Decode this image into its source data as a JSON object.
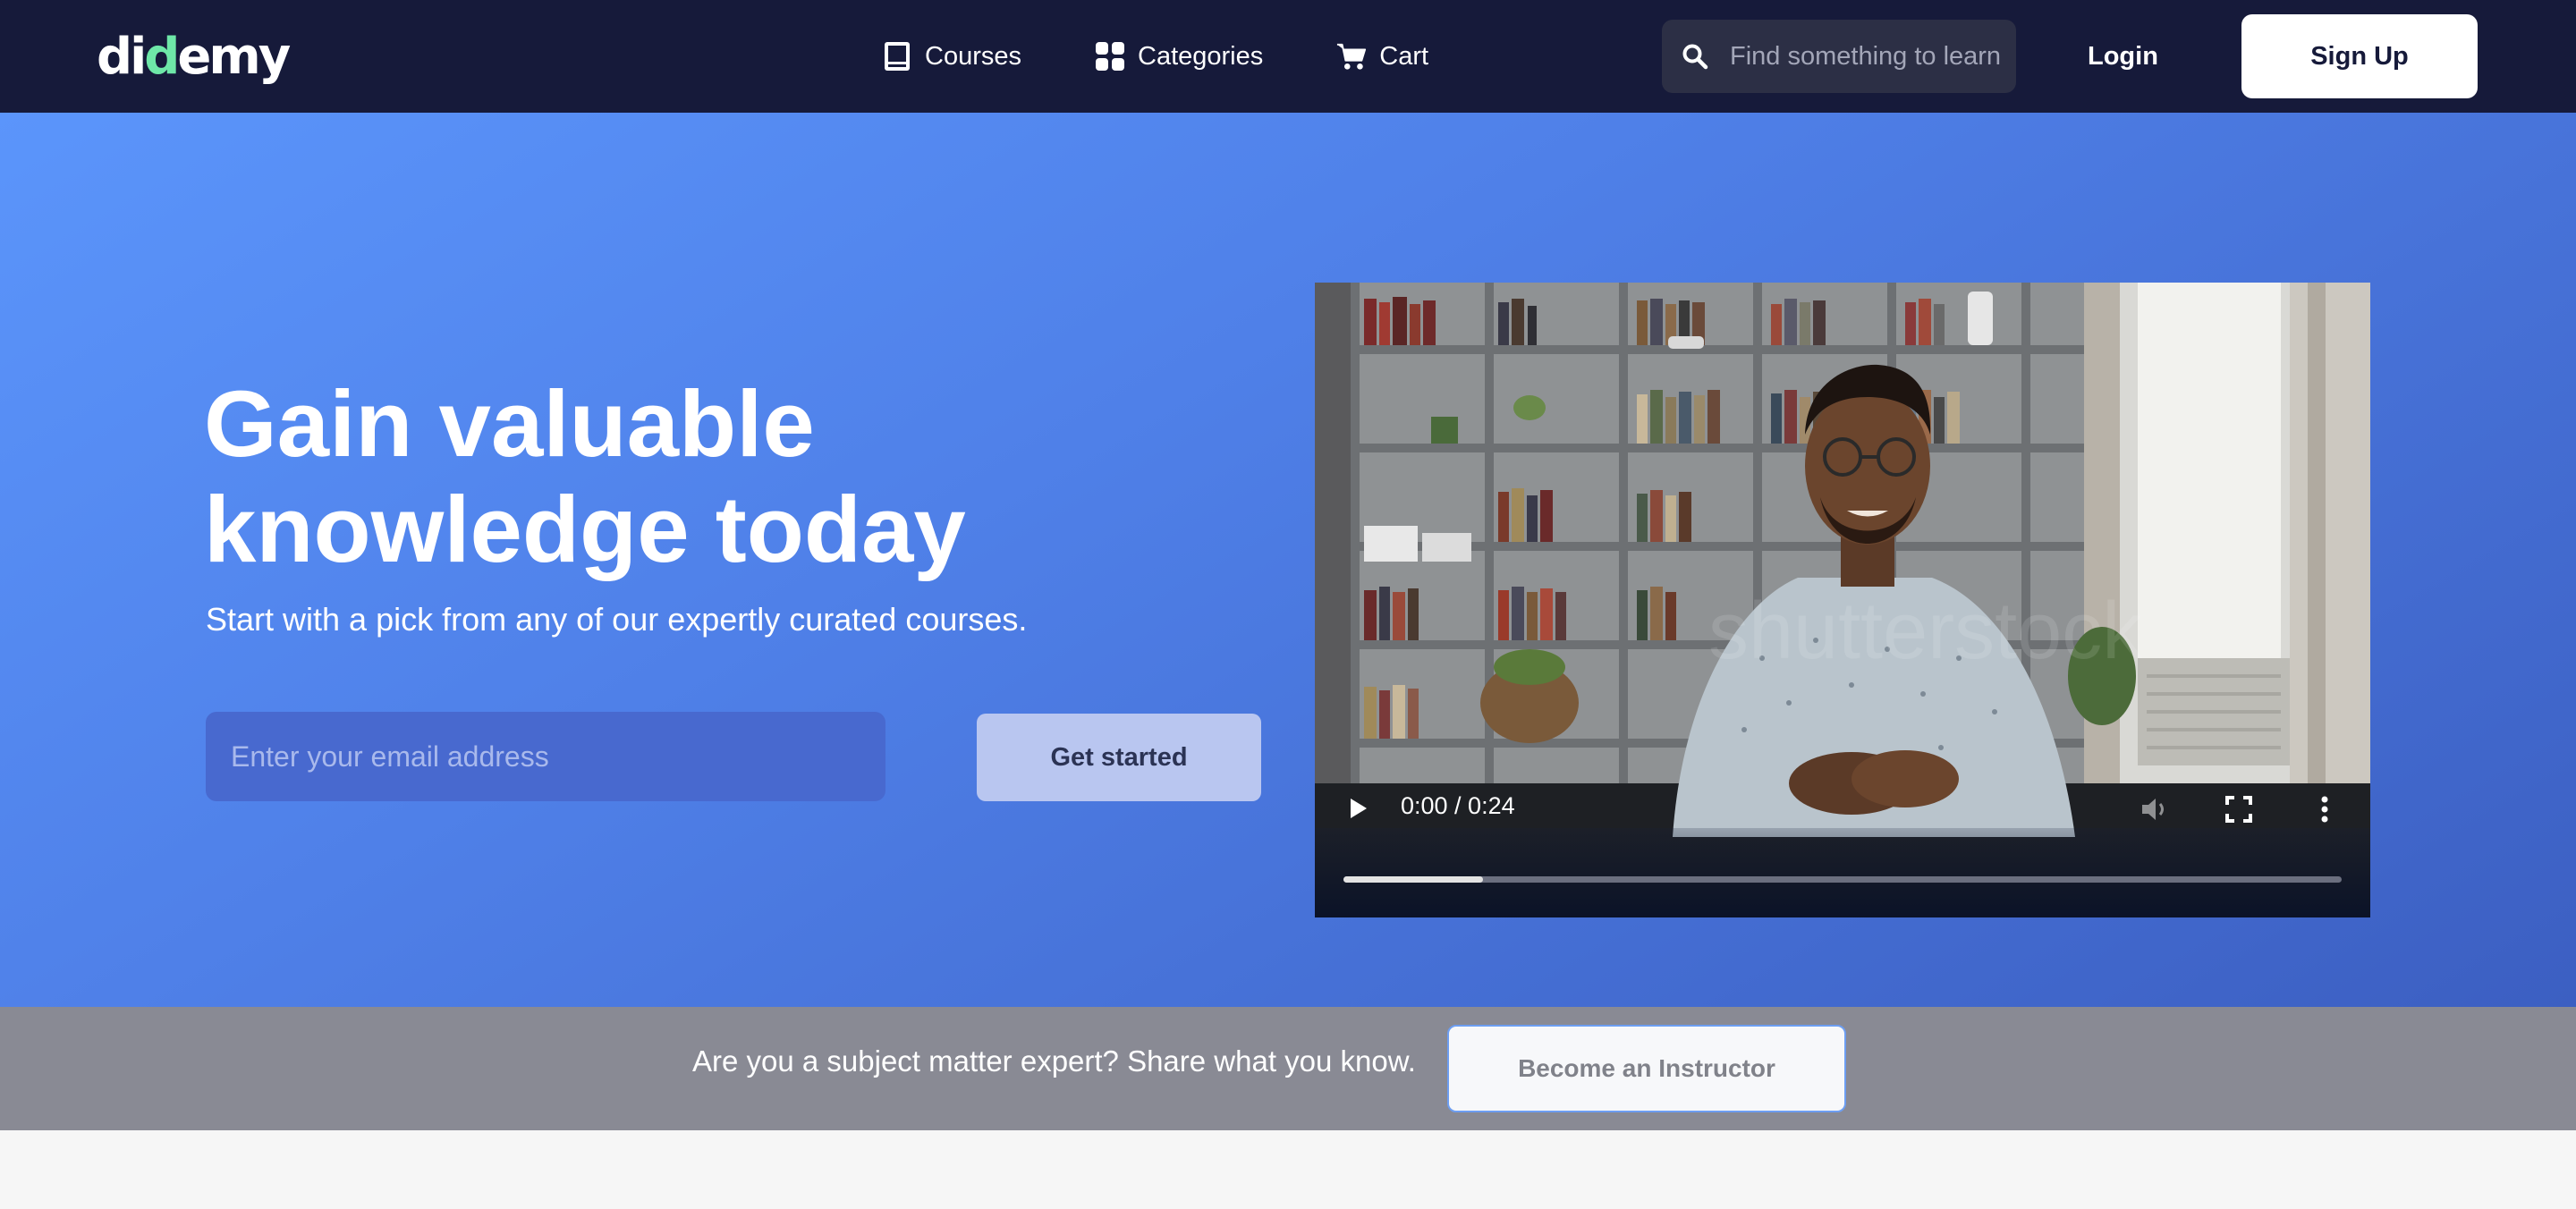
{
  "brand": {
    "logo_prefix": "di",
    "logo_accent": "d",
    "logo_suffix": "emy",
    "accent_color": "#6ee7a8"
  },
  "nav": {
    "items": [
      {
        "label": "Courses",
        "icon": "book-icon"
      },
      {
        "label": "Categories",
        "icon": "grid-icon"
      },
      {
        "label": "Cart",
        "icon": "cart-icon"
      }
    ],
    "search_placeholder": "Find something to learn",
    "login_label": "Login",
    "signup_label": "Sign Up"
  },
  "hero": {
    "title_line1": "Gain valuable",
    "title_line2": "knowledge today",
    "subtitle": "Start with a pick from any of our expertly curated courses.",
    "email_placeholder": "Enter your email address",
    "cta_label": "Get started"
  },
  "video": {
    "time_display": "0:00 / 0:24",
    "buffered_fraction": 0.14
  },
  "banner": {
    "text": "Are you a subject matter expert? Share what you know.",
    "button_label": "Become an Instructor"
  },
  "colors": {
    "navbar": "#161a3a",
    "hero_start": "#5b95fb",
    "hero_end": "#3c5fc2",
    "banner": "#898a94"
  }
}
